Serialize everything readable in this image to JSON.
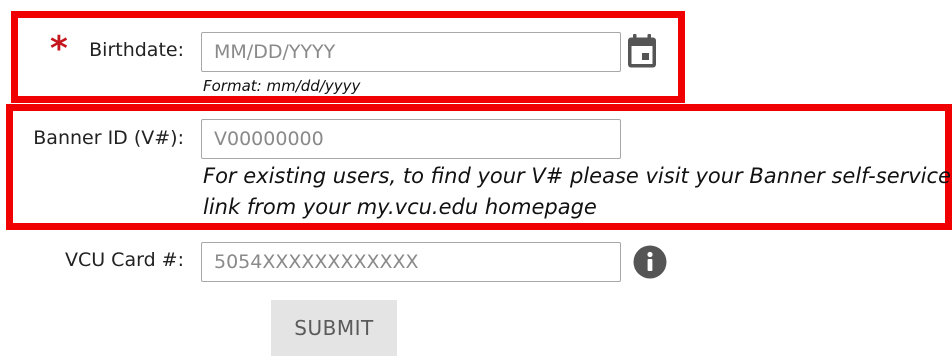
{
  "form": {
    "birthdate": {
      "required_mark": "*",
      "label": "Birthdate:",
      "placeholder": "MM/DD/YYYY",
      "value": "",
      "format_hint": "Format: mm/dd/yyyy",
      "icon": "calendar-icon"
    },
    "banner_id": {
      "label": "Banner ID (V#):",
      "placeholder": "V00000000",
      "value": "",
      "help_line_1": "For existing users, to find your V# please visit your Banner self-service",
      "help_line_2": "link from your my.vcu.edu homepage"
    },
    "vcu_card": {
      "label": "VCU Card #:",
      "placeholder": "5054XXXXXXXXXXXX",
      "value": "",
      "icon": "info-icon"
    },
    "submit_label": "SUBMIT"
  },
  "colors": {
    "highlight": "#f00000",
    "required": "#c4161c",
    "input_border": "#a8a8a8",
    "icon_gray": "#555555",
    "button_bg": "#e4e4e4",
    "button_text": "#5a5a5a"
  }
}
